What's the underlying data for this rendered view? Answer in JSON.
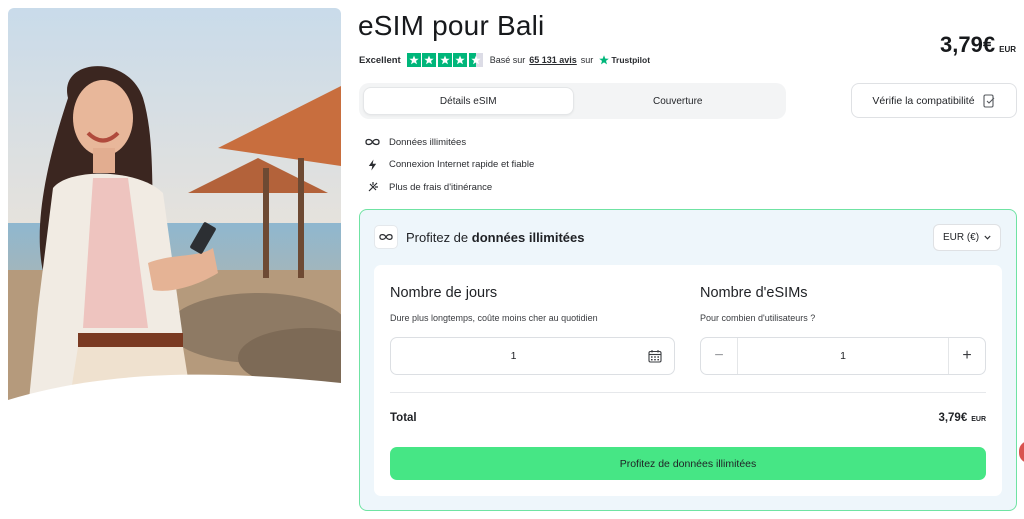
{
  "product": {
    "title": "eSIM pour Bali",
    "price": "3,79€",
    "currency_code": "EUR"
  },
  "rating": {
    "label": "Excellent",
    "stars": 4.5,
    "based_on_prefix": "Basé sur",
    "count": "65 131 avis",
    "suffix": "sur",
    "provider": "Trustpilot",
    "star_color": "#00b67a"
  },
  "tabs": [
    {
      "label": "Détails eSIM",
      "active": true
    },
    {
      "label": "Couverture",
      "active": false
    }
  ],
  "compat_button": {
    "label": "Vérifie la compatibilité",
    "icon": "phone-check-icon"
  },
  "features": [
    {
      "icon": "infinity-icon",
      "label": "Données illimitées"
    },
    {
      "icon": "bolt-icon",
      "label": "Connexion Internet rapide et fiable"
    },
    {
      "icon": "no-roaming-icon",
      "label": "Plus de frais d'itinérance"
    }
  ],
  "plan_card": {
    "heading_prefix": "Profitez de",
    "heading_bold": "données illimitées",
    "currency_select": "EUR (€)",
    "days": {
      "title": "Nombre de jours",
      "subtitle": "Dure plus longtemps, coûte moins cher au quotidien",
      "value": "1",
      "icon": "calendar-icon"
    },
    "esims": {
      "title": "Nombre d'eSIMs",
      "subtitle": "Pour combien d'utilisateurs ?",
      "value": "1",
      "minus": "−",
      "plus": "+"
    },
    "total_label": "Total",
    "total_price": "3,79€",
    "total_currency": "EUR",
    "cta_label": "Profitez de données illimitées"
  },
  "colors": {
    "accent_green": "#46e685",
    "card_border": "#6fe3a3",
    "card_bg": "#eef6fb"
  }
}
